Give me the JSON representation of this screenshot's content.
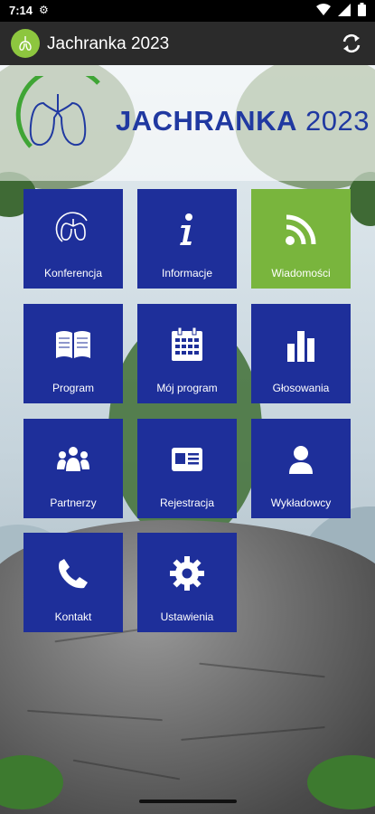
{
  "status_bar": {
    "time": "7:14"
  },
  "app_bar": {
    "title": "Jachranka 2023"
  },
  "banner": {
    "brand": "JACHRANKA",
    "year": "2023"
  },
  "colors": {
    "tile_blue": "#1e2f9a",
    "tile_green": "#79b53d",
    "brand_blue": "#2039a1",
    "logo_green": "#8dc63f"
  },
  "tiles": [
    {
      "label": "Konferencja",
      "icon": "lungs-icon"
    },
    {
      "label": "Informacje",
      "icon": "info-icon"
    },
    {
      "label": "Wiadomości",
      "icon": "rss-icon"
    },
    {
      "label": "Program",
      "icon": "book-icon"
    },
    {
      "label": "Mój program",
      "icon": "calendar-icon"
    },
    {
      "label": "Głosowania",
      "icon": "bar-chart-icon"
    },
    {
      "label": "Partnerzy",
      "icon": "people-icon"
    },
    {
      "label": "Rejestracja",
      "icon": "id-card-icon"
    },
    {
      "label": "Wykładowcy",
      "icon": "person-icon"
    },
    {
      "label": "Kontakt",
      "icon": "phone-icon"
    },
    {
      "label": "Ustawienia",
      "icon": "gear-icon"
    }
  ]
}
